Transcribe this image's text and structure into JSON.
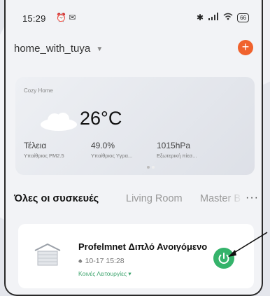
{
  "status_bar": {
    "time": "15:29",
    "battery": "66"
  },
  "home": {
    "name": "home_with_tuya"
  },
  "weather": {
    "home_label": "Cozy Home",
    "temperature": "26°C",
    "stats": [
      {
        "value": "Τέλεια",
        "label": "Υπαίθριος PM2.5"
      },
      {
        "value": "49.0%",
        "label": "Υπαίθριος Υγρα..."
      },
      {
        "value": "1015hPa",
        "label": "Εξωτερική πίεσ..."
      }
    ]
  },
  "tabs": [
    {
      "label": "Όλες οι συσκευές",
      "active": true
    },
    {
      "label": "Living Room",
      "active": false
    },
    {
      "label": "Master B",
      "active": false
    }
  ],
  "device": {
    "name": "Profelmnet Διπλό Ανοιγόμενο",
    "timestamp": "10-17 15:28",
    "functions_label": "Κοινές Λειτουργίες"
  },
  "colors": {
    "accent_orange": "#f0622d",
    "power_green": "#35b36b",
    "function_green": "#3aa36b"
  }
}
